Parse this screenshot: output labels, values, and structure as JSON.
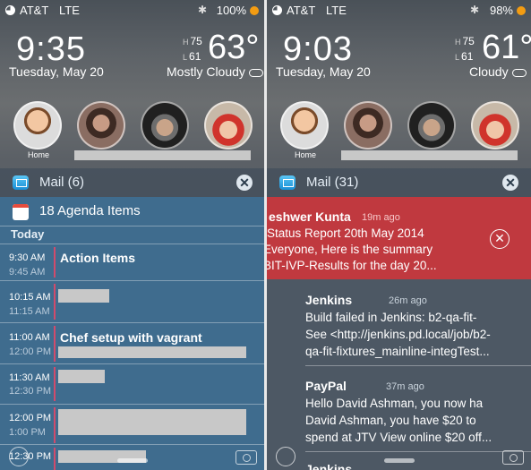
{
  "left": {
    "status": {
      "carrier": "AT&T",
      "network": "LTE",
      "battery": "100%"
    },
    "clock": {
      "time": "9:35",
      "date": "Tuesday, May 20"
    },
    "weather": {
      "high": "75",
      "low": "61",
      "temp": "63°",
      "condition": "Mostly Cloudy"
    },
    "contacts": {
      "home_label": "Home"
    },
    "mail": {
      "title": "Mail (6)"
    },
    "agenda": {
      "title": "18 Agenda Items",
      "today": "Today",
      "events": [
        {
          "start": "9:30 AM",
          "end": "9:45 AM",
          "title": "Action Items"
        },
        {
          "start": "10:15 AM",
          "end": "11:15 AM",
          "title": ""
        },
        {
          "start": "11:00 AM",
          "end": "12:00 PM",
          "title": "Chef setup with vagrant"
        },
        {
          "start": "11:30 AM",
          "end": "12:30 PM",
          "title": ""
        },
        {
          "start": "12:00 PM",
          "end": "1:00 PM",
          "title": ""
        },
        {
          "start": "12:30 PM",
          "end": "",
          "title": ""
        }
      ]
    }
  },
  "right": {
    "status": {
      "carrier": "AT&T",
      "network": "LTE",
      "battery": "98%"
    },
    "clock": {
      "time": "9:03",
      "date": "Tuesday, May 20"
    },
    "weather": {
      "high": "75",
      "low": "61",
      "temp": "61°",
      "condition": "Cloudy"
    },
    "contacts": {
      "home_label": "Home"
    },
    "mail": {
      "title": "Mail (31)"
    },
    "messages": [
      {
        "sender": "eshwer Kunta",
        "ago": "19m ago",
        "lines": [
          "Status Report  20th May 2014",
          "Everyone, Here is the summary",
          "BIT-IVP-Results for the day 20..."
        ]
      },
      {
        "sender": "Jenkins",
        "ago": "26m ago",
        "lines": [
          "Build failed in Jenkins: b2-qa-fit-",
          "See <http://jenkins.pd.local/job/b2-",
          "qa-fit-fixtures_mainline-integTest..."
        ]
      },
      {
        "sender": "PayPal",
        "ago": "37m ago",
        "lines": [
          "Hello David Ashman, you now ha",
          "David Ashman, you have $20 to",
          "spend at JTV View online $20 off..."
        ]
      },
      {
        "sender": "Jenkins",
        "ago": "",
        "lines": []
      }
    ]
  },
  "labels": {
    "h": "H",
    "l": "L"
  },
  "colors": {
    "battery_dot": "#f39c12",
    "dismiss_red": "#c0393f",
    "agenda_bg": "#3f6c8e",
    "event_bar": "#d14b6c"
  }
}
